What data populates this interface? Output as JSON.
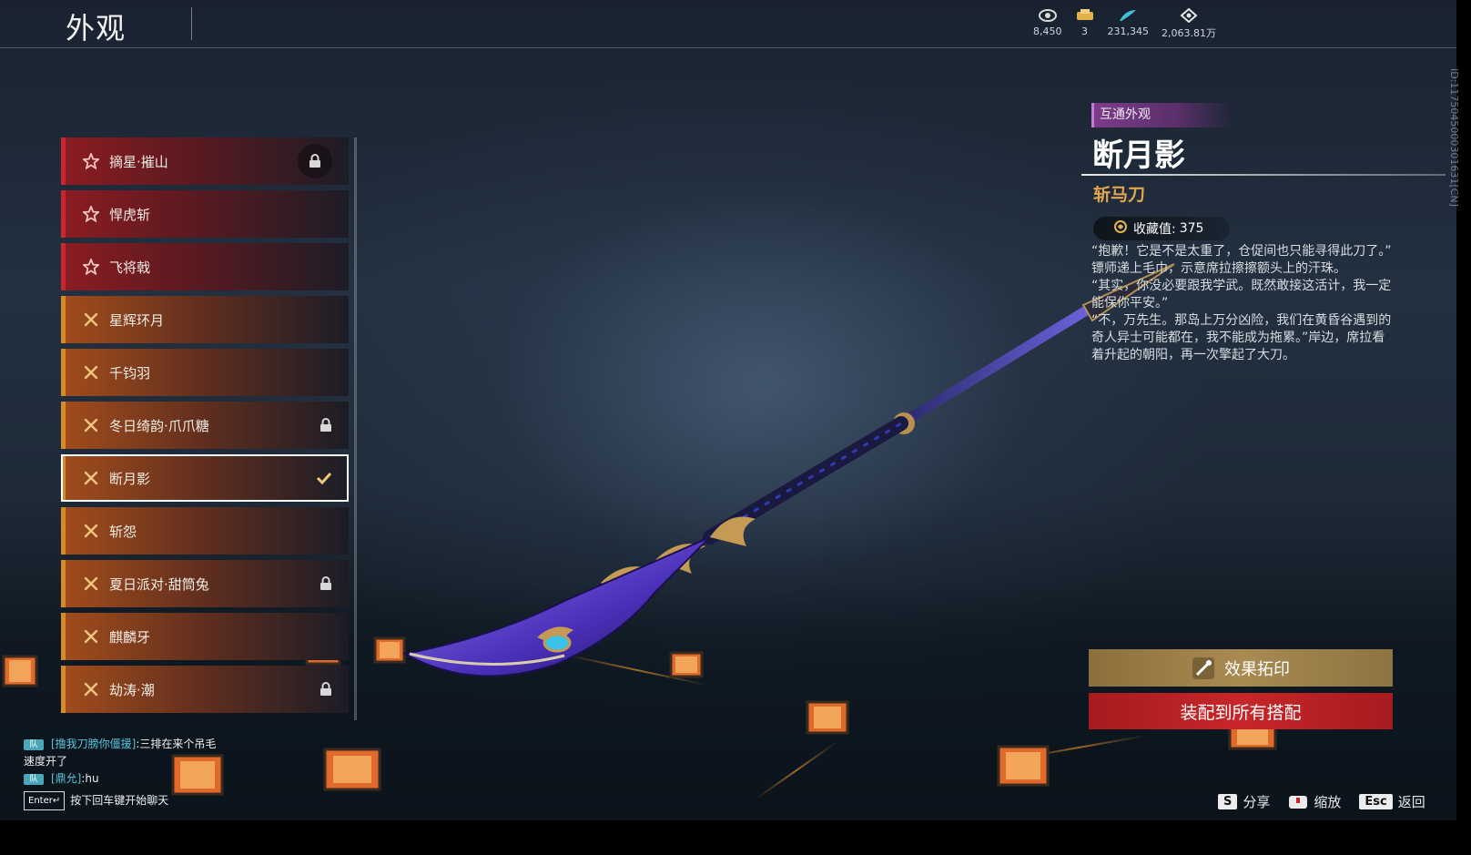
{
  "header": {
    "title": "外观",
    "currencies": [
      {
        "icon": "eye-coin-icon",
        "value": "8,450"
      },
      {
        "icon": "ticket-icon",
        "value": "3"
      },
      {
        "icon": "feather-icon",
        "value": "231,345"
      },
      {
        "icon": "diamond-icon",
        "value": "2,063.81万"
      }
    ]
  },
  "list": {
    "items": [
      {
        "label": "摘星·摧山",
        "tier": "red",
        "icon": "star-icon",
        "locked": true,
        "selected": false
      },
      {
        "label": "悍虎斩",
        "tier": "red",
        "icon": "star-icon",
        "locked": false,
        "selected": false
      },
      {
        "label": "飞将戟",
        "tier": "red",
        "icon": "star-icon",
        "locked": false,
        "selected": false
      },
      {
        "label": "星辉环月",
        "tier": "gold",
        "icon": "cross-icon",
        "locked": false,
        "selected": false
      },
      {
        "label": "千钧羽",
        "tier": "gold",
        "icon": "cross-icon",
        "locked": false,
        "selected": false
      },
      {
        "label": "冬日绮韵·爪爪糖",
        "tier": "gold",
        "icon": "cross-icon",
        "locked": true,
        "selected": false
      },
      {
        "label": "断月影",
        "tier": "gold",
        "icon": "cross-icon",
        "locked": false,
        "selected": true
      },
      {
        "label": "斩怨",
        "tier": "gold",
        "icon": "cross-icon",
        "locked": false,
        "selected": false
      },
      {
        "label": "夏日派对·甜筒兔",
        "tier": "gold",
        "icon": "cross-icon",
        "locked": true,
        "selected": false
      },
      {
        "label": "麒麟牙",
        "tier": "gold",
        "icon": "cross-icon",
        "locked": false,
        "selected": false
      },
      {
        "label": "劫涛·潮",
        "tier": "gold",
        "icon": "cross-icon",
        "locked": true,
        "selected": false
      }
    ]
  },
  "detail": {
    "tag": "互通外观",
    "name": "断月影",
    "type": "斩马刀",
    "collect_label": "收藏值:",
    "collect_value": "375",
    "description": [
      "“抱歉！它是不是太重了，仓促间也只能寻得此刀了。”",
      "镖师递上毛巾，示意席拉擦擦额头上的汗珠。",
      "“其实，你没必要跟我学武。既然敢接这活计，我一定能保你平安。”",
      "“不，万先生。那岛上万分凶险，我们在黄昏谷遇到的奇人异士可能都在，我不能成为拖累。”岸边，席拉看着升起的朝阳，再一次擎起了大刀。"
    ],
    "id_text": "ID:1175045000301631[CN]"
  },
  "actions": {
    "imprint_label": "效果拓印",
    "equip_label": "装配到所有搭配"
  },
  "hotkeys": [
    {
      "key": "S",
      "label": "分享"
    },
    {
      "key": "",
      "label": "缩放"
    },
    {
      "key": "Esc",
      "label": "返回"
    }
  ],
  "chat": {
    "lines": [
      {
        "name": "[撸我刀膀你僵援]",
        "text": ":三排在来个吊毛"
      },
      {
        "name": "",
        "text": "速度开了"
      },
      {
        "name": "[鼎允]",
        "text": ":hu"
      }
    ],
    "enter_key": "Enter↵",
    "hint": "按下回车键开始聊天"
  },
  "colors": {
    "red_tier": "#c8282c",
    "gold_tier": "#d58b2c",
    "tag_purple": "#7c3c8a",
    "type_gold": "#e1a64f",
    "equip_red": "#c8262a"
  }
}
